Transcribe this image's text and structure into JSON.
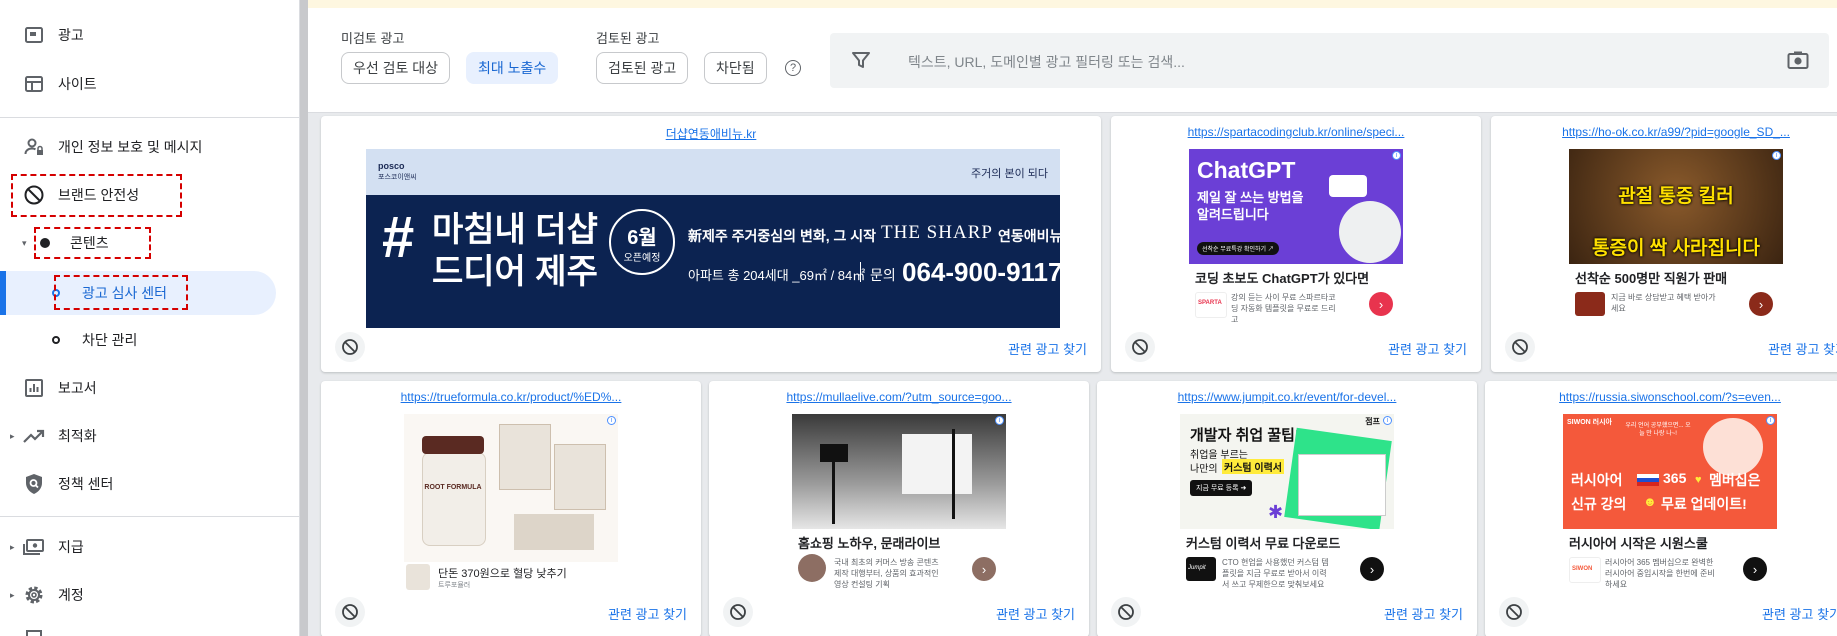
{
  "sidebar": {
    "items": [
      {
        "label": "광고"
      },
      {
        "label": "사이트"
      },
      {
        "label": "개인 정보 보호 및 메시지"
      },
      {
        "label": "브랜드 안전성"
      },
      {
        "label": "콘텐츠"
      },
      {
        "label": "광고 심사 센터"
      },
      {
        "label": "차단 관리"
      },
      {
        "label": "보고서"
      },
      {
        "label": "최적화"
      },
      {
        "label": "정책 센터"
      },
      {
        "label": "지급"
      },
      {
        "label": "계정"
      }
    ]
  },
  "filters": {
    "unreviewed_title": "미검토 광고",
    "priority_label": "우선 검토 대상",
    "max_impressions_label": "최대 노출수",
    "reviewed_title": "검토된 광고",
    "reviewed_label": "검토된 광고",
    "blocked_label": "차단됨",
    "help": "?",
    "search_placeholder": "텍스트, URL, 도메인별 광고 필터링 또는 검색..."
  },
  "colors": {
    "accent": "#1a73e8",
    "selected_chip_bg": "#e8f0fe",
    "annotation": "#d50000"
  },
  "related_label": "관련 광고 찾기",
  "ads": [
    {
      "url": "더샵연동애비뉴.kr",
      "brand": "posco",
      "brand_sub": "포스코이앤씨",
      "tagline": "주거의 본이 되다",
      "headline_1": "마침내 더샵",
      "headline_2": "드디어 제주",
      "month": "6월",
      "opening": "오픈예정",
      "subline": "新제주 주거중심의 변화, 그 시작",
      "brand_name": "THE SHARP",
      "project": "연동애비뉴",
      "units": "아파트 총 204세대 _69㎡ / 84㎡",
      "contact_label": "문의",
      "phone": "064-900-9117"
    },
    {
      "url": "https://spartacodingclub.kr/online/speci...",
      "img_title": "ChatGPT",
      "img_sub_1": "제일 잘 쓰는 방법을",
      "img_sub_2": "알려드립니다",
      "img_note": "선착순 무료특강 확인하기 ↗",
      "title": "코딩 초보도 ChatGPT가 있다면",
      "desc": "강의 듣는 사이 무료 스파르타코딩 자동화 템플릿을 무료로 드리고",
      "logo": "SPARTA"
    },
    {
      "url": "https://ho-ok.co.kr/a99/?pid=google_SD_...",
      "img_text_1": "관절 통증 킬러",
      "img_text_2": "통증이 싹 사라집니다",
      "title": "선착순 500명만 직원가 판매",
      "desc": "지금 바로 상담받고 혜택 받아가세요"
    },
    {
      "url": "https://trueformula.co.kr/product/%ED%...",
      "product": "ROOT FORMULA",
      "title": "단돈 370원으로 혈당 낮추기",
      "desc": "트루포뮬러"
    },
    {
      "url": "https://mullaelive.com/?utm_source=goo...",
      "title": "홈쇼핑 노하우, 문래라이브",
      "desc": "국내 최초의 커머스 방송 콘텐츠 제작 대행부터, 상품의 효과적인 영상 컨설팅 기획"
    },
    {
      "url": "https://www.jumpit.co.kr/event/for-devel...",
      "img_title": "개발자 취업 꿀팁!",
      "img_sub_1": "취업을 부르는",
      "img_sub_2": "나만의",
      "img_highlight": "커스텀 이력서",
      "img_btn": "지금 무료 등록 ➜",
      "img_badge": "점프",
      "title": "커스텀 이력서 무료 다운로드",
      "desc": "CTO 현업을 사용했던 커스텀 템플릿을 지금 무료로 받아서 이력서 쓰고 무제한으로 맞춰보세요",
      "logo": "Jumpit"
    },
    {
      "url": "https://russia.siwonschool.com/?s=even...",
      "img_brand": "SIWON 러시아",
      "img_small": "우리 언어 공부했으면... 오늘 만 나랑 나~!",
      "img_text_1": "러시아어",
      "img_text_365": "365",
      "img_text_2": "멤버십은",
      "img_text_3": "신규 강의",
      "img_text_4": "무료 업데이트!",
      "title": "러시아어 시작은 시원스쿨",
      "desc": "러시아어 365 멤버십으로 완벽한 러시아어 중입시작을 한번에 준비하세요",
      "logo": "SIWON"
    }
  ]
}
